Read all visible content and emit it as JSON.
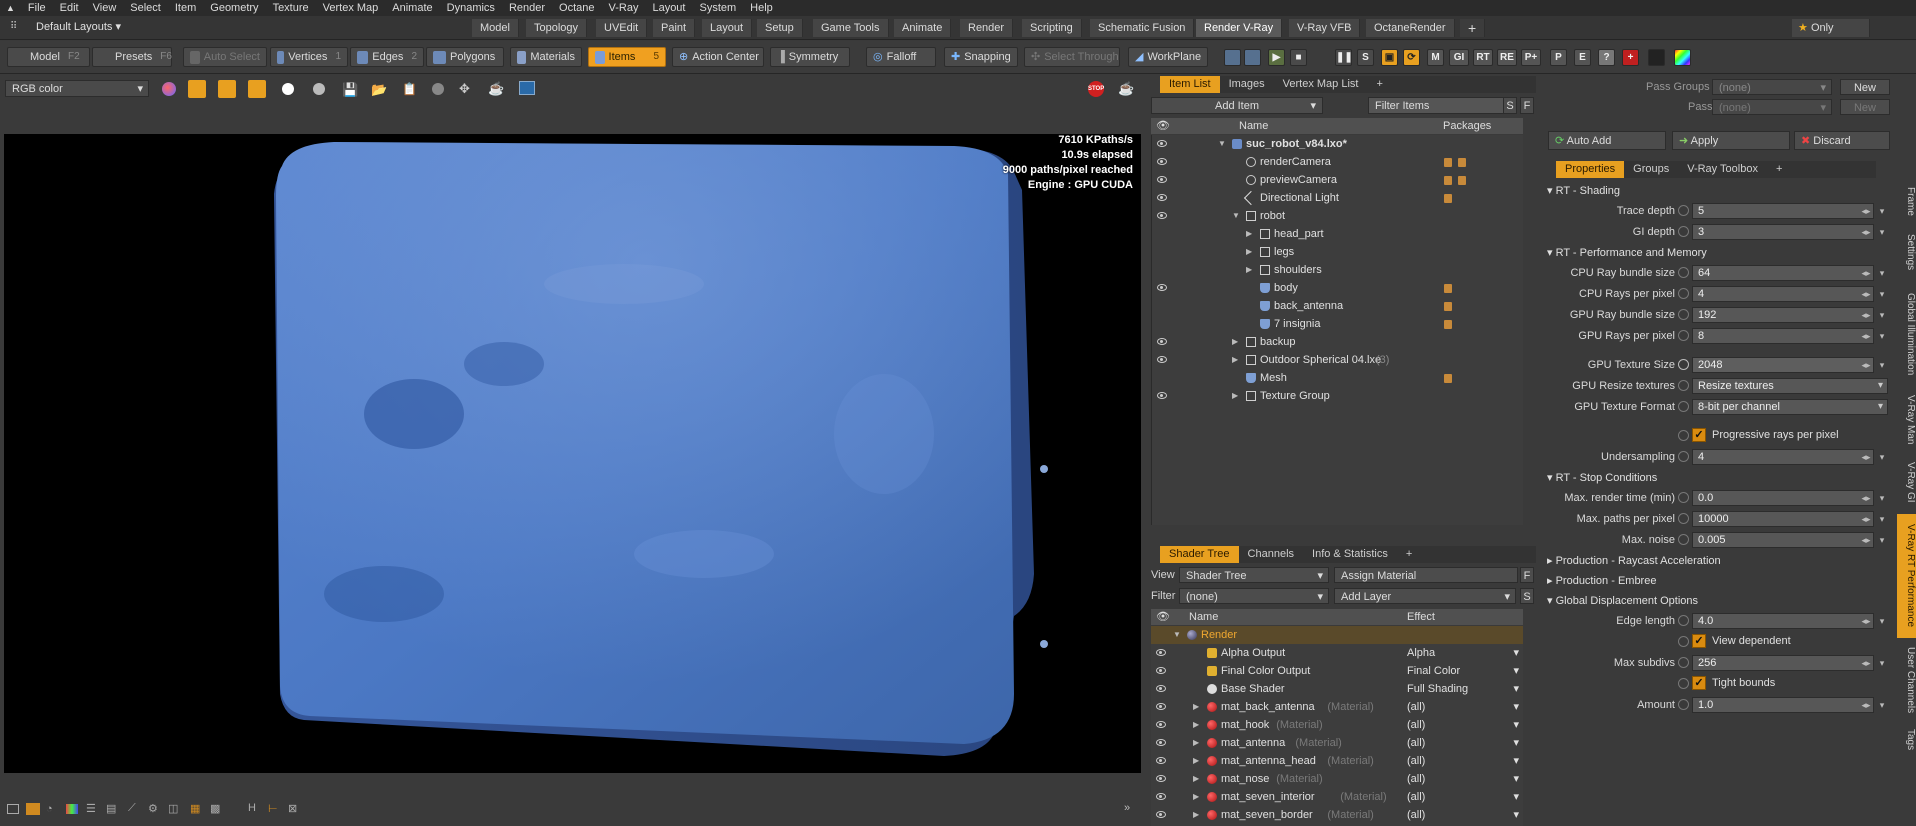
{
  "menubar": [
    "File",
    "Edit",
    "View",
    "Select",
    "Item",
    "Geometry",
    "Texture",
    "Vertex Map",
    "Animate",
    "Dynamics",
    "Render",
    "Octane",
    "V-Ray",
    "Layout",
    "System",
    "Help"
  ],
  "layout": {
    "preset": "Default Layouts",
    "tabs": [
      "Model",
      "Topology",
      "UVEdit",
      "Paint",
      "Layout",
      "Setup",
      "Game Tools",
      "Animate",
      "Render",
      "Scripting",
      "Schematic Fusion",
      "Render V-Ray",
      "V-Ray VFB",
      "OctaneRender"
    ],
    "active_tab": "Render V-Ray",
    "add": "+",
    "only": "Only"
  },
  "toolbar": {
    "model": "Model",
    "model_key": "F2",
    "presets": "Presets",
    "presets_key": "F6",
    "auto_select": "Auto Select",
    "vertices": "Vertices",
    "vertices_key": "1",
    "edges": "Edges",
    "edges_key": "2",
    "polygons": "Polygons",
    "materials": "Materials",
    "items": "Items",
    "items_key": "5",
    "action_center": "Action Center",
    "symmetry": "Symmetry",
    "falloff": "Falloff",
    "snapping": "Snapping",
    "select_through": "Select Through",
    "workplane": "WorkPlane",
    "render_btns": [
      "S",
      "M",
      "GI",
      "RT",
      "RE",
      "P+",
      "P",
      "E",
      "?"
    ]
  },
  "viewport": {
    "display_mode": "RGB color",
    "stats": [
      "7610 KPaths/s",
      "10.9s elapsed",
      "9000 paths/pixel reached",
      "Engine : GPU CUDA"
    ],
    "colors": {
      "object": "#4b76c2",
      "background": "#000000"
    }
  },
  "item_list": {
    "tabs": [
      "Item List",
      "Images",
      "Vertex Map List"
    ],
    "active_tab": "Item List",
    "add_item": "Add Item",
    "filter": "Filter Items",
    "col_name": "Name",
    "col_packages": "Packages",
    "rows": [
      {
        "name": "suc_robot_v84.lxo*",
        "depth": 0,
        "eye": true,
        "bold": true,
        "icon": "scene",
        "pkg": 0
      },
      {
        "name": "renderCamera",
        "depth": 1,
        "eye": true,
        "icon": "camera",
        "pkg": 2
      },
      {
        "name": "previewCamera",
        "depth": 1,
        "eye": true,
        "icon": "camera",
        "pkg": 2
      },
      {
        "name": "Directional Light",
        "depth": 1,
        "eye": true,
        "icon": "light",
        "pkg": 1
      },
      {
        "name": "robot",
        "depth": 1,
        "eye": true,
        "icon": "folder",
        "expanded": true,
        "pkg": 0
      },
      {
        "name": "head_part",
        "depth": 2,
        "eye": false,
        "icon": "folder",
        "pkg": 0
      },
      {
        "name": "legs",
        "depth": 2,
        "eye": false,
        "icon": "folder",
        "pkg": 0
      },
      {
        "name": "shoulders",
        "depth": 2,
        "eye": false,
        "icon": "folder",
        "pkg": 0
      },
      {
        "name": "body",
        "depth": 2,
        "eye": true,
        "icon": "mesh",
        "pkg": 1
      },
      {
        "name": "back_antenna",
        "depth": 2,
        "eye": false,
        "icon": "mesh",
        "pkg": 1
      },
      {
        "name": "7 insignia",
        "depth": 2,
        "eye": false,
        "icon": "mesh",
        "pkg": 1
      },
      {
        "name": "backup",
        "depth": 1,
        "eye": true,
        "icon": "folder",
        "pkg": 0
      },
      {
        "name": "Outdoor Spherical 04.lxe",
        "suffix": "(3)",
        "depth": 1,
        "eye": true,
        "icon": "folder",
        "pkg": 0
      },
      {
        "name": "Mesh",
        "depth": 1,
        "eye": false,
        "icon": "mesh",
        "pkg": 1
      },
      {
        "name": "Texture Group",
        "depth": 1,
        "eye": true,
        "icon": "folder",
        "pkg": 0
      }
    ]
  },
  "shader_tree": {
    "tabs": [
      "Shader Tree",
      "Channels",
      "Info & Statistics"
    ],
    "active_tab": "Shader Tree",
    "view_label": "View",
    "view_value": "Shader Tree",
    "assign": "Assign Material",
    "filter_label": "Filter",
    "filter_value": "(none)",
    "add_layer": "Add Layer",
    "col_name": "Name",
    "col_effect": "Effect",
    "rows": [
      {
        "name": "Render",
        "effect": "",
        "type": "render"
      },
      {
        "name": "Alpha Output",
        "effect": "Alpha",
        "type": "output"
      },
      {
        "name": "Final Color Output",
        "effect": "Final Color",
        "type": "output"
      },
      {
        "name": "Base Shader",
        "effect": "Full Shading",
        "type": "shader"
      },
      {
        "name": "mat_back_antenna",
        "tag": "(Material)",
        "effect": "(all)",
        "type": "material"
      },
      {
        "name": "mat_hook",
        "tag": "(Material)",
        "effect": "(all)",
        "type": "material"
      },
      {
        "name": "mat_antenna",
        "tag": "(Material)",
        "effect": "(all)",
        "type": "material"
      },
      {
        "name": "mat_antenna_head",
        "tag": "(Material)",
        "effect": "(all)",
        "type": "material"
      },
      {
        "name": "mat_nose",
        "tag": "(Material)",
        "effect": "(all)",
        "type": "material"
      },
      {
        "name": "mat_seven_interior",
        "tag": "(Material)",
        "effect": "(all)",
        "type": "material"
      },
      {
        "name": "mat_seven_border",
        "tag": "(Material)",
        "effect": "(all)",
        "type": "material"
      }
    ]
  },
  "pass": {
    "groups_label": "Pass Groups",
    "groups_value": "(none)",
    "passes_label": "Passes",
    "passes_value": "(none)",
    "new": "New",
    "auto_add": "Auto Add",
    "apply": "Apply",
    "discard": "Discard"
  },
  "properties": {
    "tabs": [
      "Properties",
      "Groups",
      "V-Ray Toolbox"
    ],
    "active_tab": "Properties",
    "rt_shading": "RT - Shading",
    "trace_depth_label": "Trace depth",
    "trace_depth": "5",
    "gi_depth_label": "GI depth",
    "gi_depth": "3",
    "rt_perf": "RT - Performance and Memory",
    "cpu_bundle_label": "CPU Ray bundle size",
    "cpu_bundle": "64",
    "cpu_rays_label": "CPU Rays per pixel",
    "cpu_rays": "4",
    "gpu_bundle_label": "GPU Ray bundle size",
    "gpu_bundle": "192",
    "gpu_rays_label": "GPU Rays per pixel",
    "gpu_rays": "8",
    "gpu_tex_size_label": "GPU Texture Size",
    "gpu_tex_size": "2048",
    "gpu_resize_label": "GPU Resize textures",
    "gpu_resize": "Resize textures",
    "gpu_format_label": "GPU Texture Format",
    "gpu_format": "8-bit per channel",
    "progressive_label": "Progressive rays per pixel",
    "undersampling_label": "Undersampling",
    "undersampling": "4",
    "rt_stop": "RT - Stop Conditions",
    "max_time_label": "Max. render time (min)",
    "max_time": "0.0",
    "max_paths_label": "Max. paths per pixel",
    "max_paths": "10000",
    "max_noise_label": "Max. noise",
    "max_noise": "0.005",
    "raycast": "Production - Raycast Acceleration",
    "embree": "Production - Embree",
    "displacement": "Global Displacement Options",
    "edge_length_label": "Edge length",
    "edge_length": "4.0",
    "view_dep_label": "View dependent",
    "max_subdivs_label": "Max subdivs",
    "max_subdivs": "256",
    "tight_label": "Tight bounds",
    "amount_label": "Amount",
    "amount": "1.0"
  },
  "side_tabs": [
    "Frame",
    "Settings",
    "Global Illumination",
    "V-Ray Man",
    "V-Ray GI",
    "V-Ray RT Performance",
    "User Channels",
    "Tags"
  ],
  "side_active": "V-Ray RT Performance"
}
